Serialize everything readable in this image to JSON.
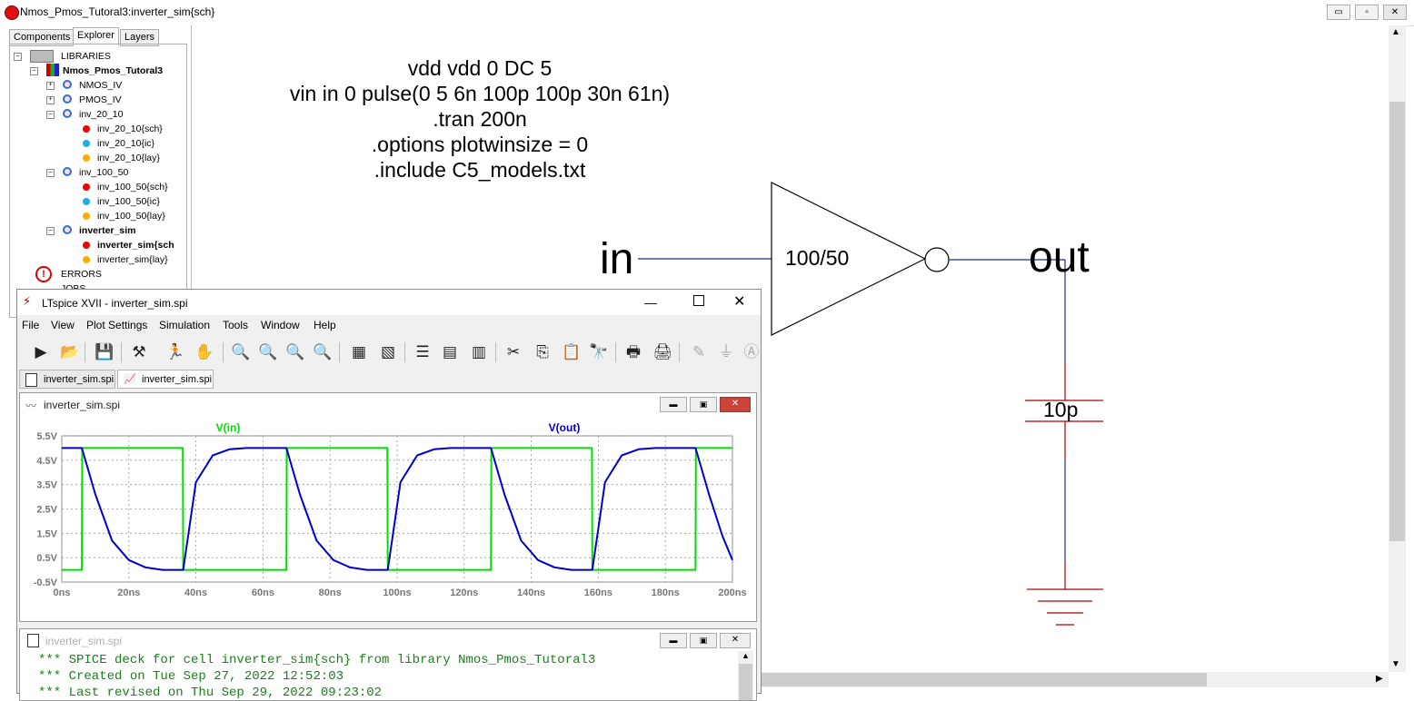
{
  "main_window": {
    "title": "Nmos_Pmos_Tutoral3:inverter_sim{sch}",
    "controls": [
      "▭",
      "▫",
      "✕"
    ]
  },
  "left_panel": {
    "tabs": [
      "Components",
      "Explorer",
      "Layers"
    ],
    "active_tab": "Explorer",
    "tree": [
      {
        "label": "LIBRARIES",
        "box": "–"
      },
      {
        "label": "Nmos_Pmos_Tutoral3",
        "box": "–"
      },
      {
        "label": "NMOS_IV",
        "box": "+"
      },
      {
        "label": "PMOS_IV",
        "box": "+"
      },
      {
        "label": "inv_20_10",
        "box": "–"
      },
      {
        "label": "inv_20_10{sch}"
      },
      {
        "label": "inv_20_10{ic}"
      },
      {
        "label": "inv_20_10{lay}"
      },
      {
        "label": "inv_100_50",
        "box": "–"
      },
      {
        "label": "inv_100_50{sch}"
      },
      {
        "label": "inv_100_50{ic}"
      },
      {
        "label": "inv_100_50{lay}"
      },
      {
        "label": "inverter_sim",
        "box": "–"
      },
      {
        "label": "inverter_sim{sch"
      },
      {
        "label": "inverter_sim{lay}"
      },
      {
        "label": "ERRORS"
      },
      {
        "label": "JOBS"
      }
    ]
  },
  "schematic": {
    "spice_lines": [
      "vdd vdd 0 DC 5",
      "vin in 0 pulse(0 5 6n 100p 100p 30n 61n)",
      ".tran 200n",
      ".options plotwinsize = 0",
      ".include C5_models.txt"
    ],
    "in_label": "in",
    "out_label": "out",
    "inverter_label": "100/50",
    "cap_label": "10p"
  },
  "ltspice": {
    "title": "LTspice XVII - inverter_sim.spi",
    "menu": [
      "File",
      "View",
      "Plot Settings",
      "Simulation",
      "Tools",
      "Window",
      "Help"
    ],
    "tabs": [
      "inverter_sim.spi",
      "inverter_sim.spi"
    ],
    "plot_window_title": "inverter_sim.spi",
    "netlist_window_title": "inverter_sim.spi",
    "netlist_lines": [
      "*** SPICE deck for cell inverter_sim{sch} from library Nmos_Pmos_Tutoral3",
      "*** Created on Tue Sep 27, 2022 12:52:03",
      "*** Last revised on Thu Sep 29, 2022 09:23:02"
    ]
  },
  "chart_data": {
    "type": "line",
    "title": "",
    "xlabel": "",
    "ylabel": "",
    "xlim": [
      0,
      200
    ],
    "ylim": [
      -0.5,
      5.5
    ],
    "x_ticks": [
      "0ns",
      "20ns",
      "40ns",
      "60ns",
      "80ns",
      "100ns",
      "120ns",
      "140ns",
      "160ns",
      "180ns",
      "200ns"
    ],
    "y_ticks": [
      "5.5V",
      "4.5V",
      "3.5V",
      "2.5V",
      "1.5V",
      "0.5V",
      "-0.5V"
    ],
    "grid": true,
    "series": [
      {
        "name": "V(in)",
        "color": "#00dd00",
        "x": [
          0,
          6,
          6.1,
          36.1,
          36.2,
          67,
          67.1,
          97.1,
          97.2,
          128,
          128.1,
          158.1,
          158.2,
          189,
          189.1,
          200
        ],
        "y": [
          0,
          0,
          5,
          5,
          0,
          0,
          5,
          5,
          0,
          0,
          5,
          5,
          0,
          0,
          5,
          5
        ]
      },
      {
        "name": "V(out)",
        "color": "#0000cc",
        "x": [
          0,
          6,
          10,
          15,
          20,
          25,
          30,
          36.2,
          40,
          45,
          50,
          55,
          60,
          67,
          71,
          76,
          81,
          86,
          91,
          97.2,
          101,
          106,
          111,
          116,
          121,
          128,
          132,
          137,
          142,
          147,
          152,
          158.2,
          162,
          167,
          172,
          177,
          182,
          189,
          193,
          197,
          200
        ],
        "y": [
          5,
          5,
          3.1,
          1.2,
          0.4,
          0.1,
          0,
          0,
          3.6,
          4.7,
          4.95,
          5,
          5,
          5,
          3.1,
          1.2,
          0.4,
          0.1,
          0,
          0,
          3.6,
          4.7,
          4.95,
          5,
          5,
          5,
          3.1,
          1.2,
          0.4,
          0.1,
          0,
          0,
          3.6,
          4.7,
          4.95,
          5,
          5,
          5,
          3.1,
          1.4,
          0.4
        ]
      }
    ]
  }
}
